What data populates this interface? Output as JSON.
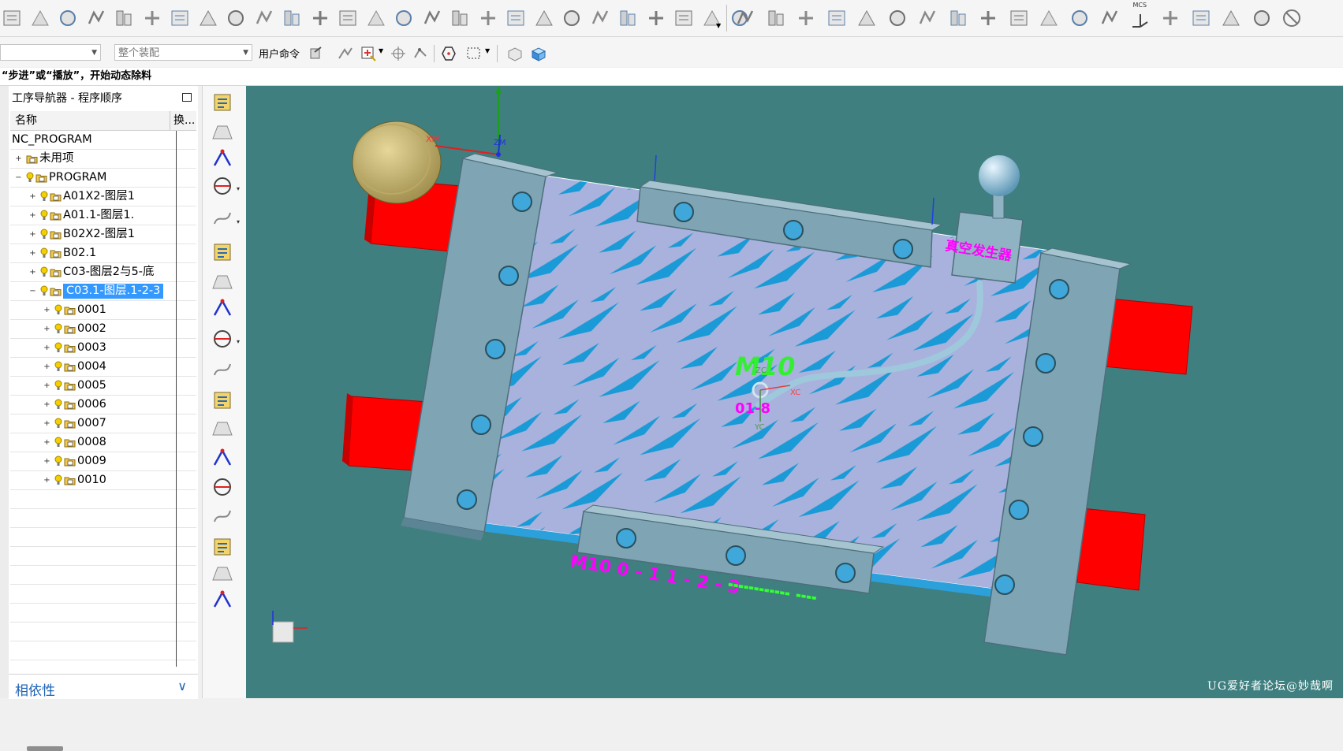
{
  "toolbar_top": {
    "icons": [
      "manufacturing-icon",
      "copy-icon",
      "transfer-icon",
      "ungroup-icon",
      "wire-icon",
      "edit-obj-icon",
      "display-icon",
      "align-icon",
      "layer-icon",
      "move-icon",
      "object-icon",
      "measure-icon",
      "section-icon",
      "render-icon",
      "text-icon",
      "curve-icon",
      "sheet-icon",
      "page-icon",
      "chart-icon",
      "mark-icon",
      "crane-icon",
      "print-icon",
      "swap-icon",
      "tool-icon",
      "grid-icon",
      "calculator-icon",
      "clock-icon"
    ],
    "icons_right": [
      "assembly-icon",
      "box-icon",
      "solid-icon",
      "stack-icon",
      "wire-box-icon",
      "view-icon",
      "mesh-icon",
      "shade-icon",
      "hatch-icon",
      "dimension-icon",
      "axis-icon",
      "table-icon",
      "bars-icon",
      "mcs-icon",
      "clamp-icon",
      "doc-icon",
      "layout-icon",
      "check-icon",
      "no-icon"
    ],
    "mcs_label": "MCS"
  },
  "toolbar_second": {
    "left_combo": "",
    "assembly_combo": "整个装配",
    "user_command_label": "用户命令"
  },
  "status": {
    "message": "“步进”或“播放”，开始动态除料"
  },
  "navigator": {
    "title": "工序导航器 - 程序顺序",
    "columns": {
      "name": "名称",
      "change": "换..."
    },
    "rows": [
      {
        "label": "NC_PROGRAM",
        "level": 0,
        "expander": "",
        "bulb": false,
        "folder": false
      },
      {
        "label": "未用项",
        "level": 0,
        "expander": "+",
        "bulb": false,
        "folder": true
      },
      {
        "label": "PROGRAM",
        "level": 0,
        "expander": "−",
        "bulb": true,
        "folder": true
      },
      {
        "label": "A01X2-图层1",
        "level": 1,
        "expander": "+",
        "bulb": true,
        "folder": true
      },
      {
        "label": "A01.1-图层1.",
        "level": 1,
        "expander": "+",
        "bulb": true,
        "folder": true
      },
      {
        "label": "B02X2-图层1",
        "level": 1,
        "expander": "+",
        "bulb": true,
        "folder": true
      },
      {
        "label": "B02.1",
        "level": 1,
        "expander": "+",
        "bulb": true,
        "folder": true
      },
      {
        "label": "C03-图层2与5-底",
        "level": 1,
        "expander": "+",
        "bulb": true,
        "folder": true
      },
      {
        "label": "C03.1-图层.1-2-3",
        "level": 1,
        "expander": "−",
        "bulb": true,
        "folder": true,
        "selected": true
      },
      {
        "label": "0001",
        "level": 2,
        "expander": "+",
        "bulb": true,
        "folder": true
      },
      {
        "label": "0002",
        "level": 2,
        "expander": "+",
        "bulb": true,
        "folder": true
      },
      {
        "label": "0003",
        "level": 2,
        "expander": "+",
        "bulb": true,
        "folder": true
      },
      {
        "label": "0004",
        "level": 2,
        "expander": "+",
        "bulb": true,
        "folder": true
      },
      {
        "label": "0005",
        "level": 2,
        "expander": "+",
        "bulb": true,
        "folder": true
      },
      {
        "label": "0006",
        "level": 2,
        "expander": "+",
        "bulb": true,
        "folder": true
      },
      {
        "label": "0007",
        "level": 2,
        "expander": "+",
        "bulb": true,
        "folder": true
      },
      {
        "label": "0008",
        "level": 2,
        "expander": "+",
        "bulb": true,
        "folder": true
      },
      {
        "label": "0009",
        "level": 2,
        "expander": "+",
        "bulb": true,
        "folder": true
      },
      {
        "label": "0010",
        "level": 2,
        "expander": "+",
        "bulb": true,
        "folder": true
      }
    ]
  },
  "relations_panel": {
    "title": "相依性"
  },
  "resource_bar": {
    "icons": [
      "part-navigator-icon",
      "operation-navigator-icon",
      "layer-list-icon",
      "csys-icon",
      "roles-icon",
      "model-icon",
      "plane-icon",
      "stack-layer-icon",
      "dimension-tool-icon",
      "angle-icon",
      "arc-icon",
      "circle-measure-icon",
      "ruler-icon",
      "surface-icon",
      "info-icon",
      "curve1-icon",
      "curve2-icon",
      "curve3-icon"
    ]
  },
  "viewport": {
    "background": "#3f7f7f",
    "labels": {
      "vacuum_generator": "真空发生器",
      "wcs_x": "XC",
      "wcs_y": "YC",
      "wcs_z": "ZC",
      "mcs_x": "XM",
      "mcs_z": "ZM",
      "part_text": "M10",
      "part_text2": "01-8"
    },
    "colors": {
      "plate": "#a8b0d8",
      "stripes": "#1a9ad6",
      "clamp": "#7fa5b5",
      "block": "#ff0000",
      "tube": "#9ec8dc",
      "magenta": "#ff00ff"
    },
    "watermark": "UG爱好者论坛@妙哉啊"
  }
}
